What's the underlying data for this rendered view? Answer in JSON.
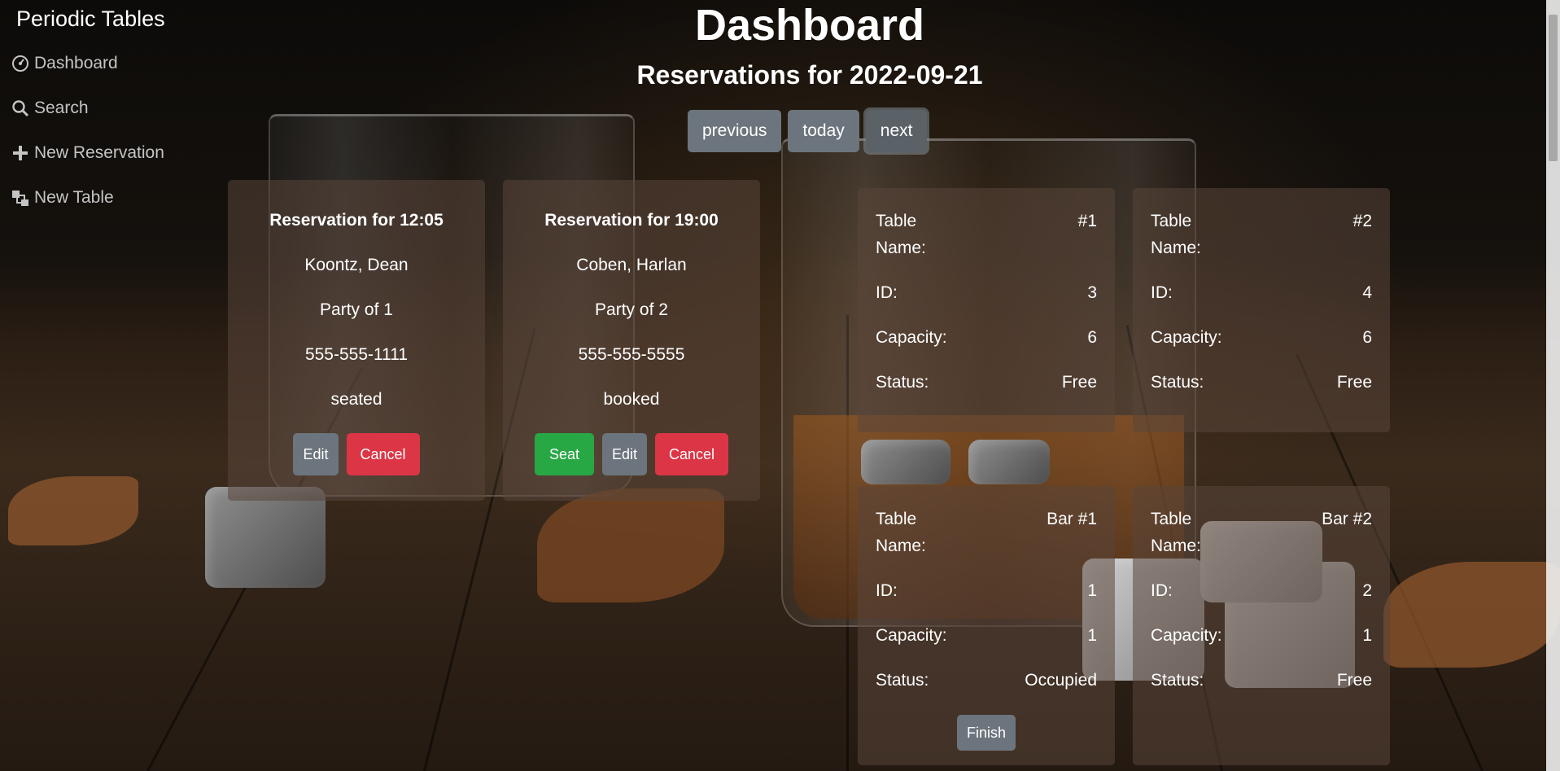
{
  "brand": "Periodic Tables",
  "nav": [
    {
      "label": "Dashboard",
      "icon": "dashboard-icon"
    },
    {
      "label": "Search",
      "icon": "search-icon"
    },
    {
      "label": "New Reservation",
      "icon": "plus-icon"
    },
    {
      "label": "New Table",
      "icon": "table-icon"
    }
  ],
  "header": {
    "title": "Dashboard",
    "subtitle": "Reservations for 2022-09-21"
  },
  "date_nav": {
    "previous": "previous",
    "today": "today",
    "next": "next"
  },
  "reservations": [
    {
      "title": "Reservation for 12:05",
      "name": "Koontz, Dean",
      "party": "Party of 1",
      "phone": "555-555-1111",
      "status": "seated",
      "edit": "Edit",
      "cancel": "Cancel"
    },
    {
      "title": "Reservation for 19:00",
      "name": "Coben, Harlan",
      "party": "Party of 2",
      "phone": "555-555-5555",
      "status": "booked",
      "seat": "Seat",
      "edit": "Edit",
      "cancel": "Cancel"
    }
  ],
  "table_labels": {
    "name_line1": "Table",
    "name_line2": "Name:",
    "id": "ID:",
    "capacity": "Capacity:",
    "status": "Status:"
  },
  "tables": [
    {
      "name": "#1",
      "id": "3",
      "capacity": "6",
      "status": "Free"
    },
    {
      "name": "#2",
      "id": "4",
      "capacity": "6",
      "status": "Free"
    },
    {
      "name": "Bar #1",
      "id": "1",
      "capacity": "1",
      "status": "Occupied",
      "finish": "Finish"
    },
    {
      "name": "Bar #2",
      "id": "2",
      "capacity": "1",
      "status": "Free"
    }
  ]
}
